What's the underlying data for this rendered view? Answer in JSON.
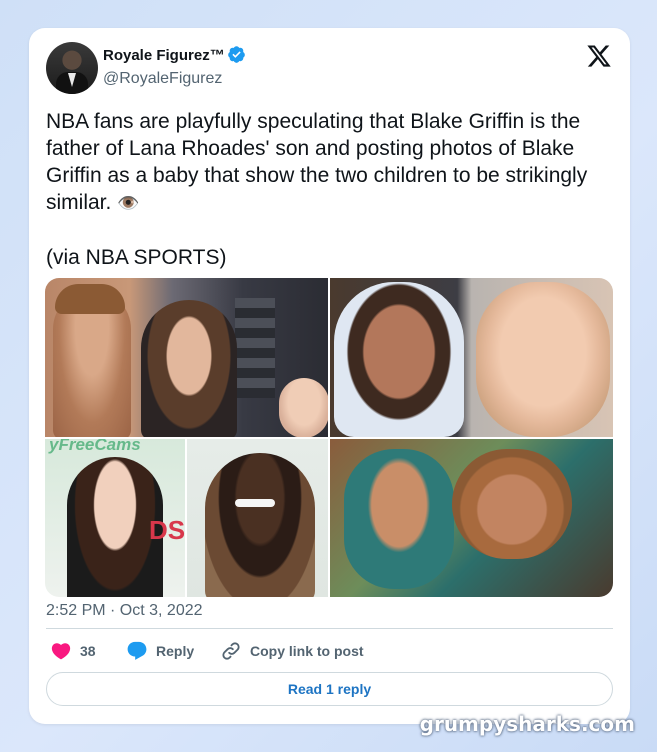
{
  "author": {
    "name": "Royale Figurez™",
    "handle": "@RoyaleFigurez",
    "verified": true
  },
  "tweet": {
    "text": "NBA fans are playfully speculating that Blake Griffin is the father of Lana Rhoades' son and posting photos of Blake Griffin as a baby that show the two children to be strikingly similar. ",
    "emoji": "👁️",
    "source_line": "(via NBA SPORTS)",
    "timestamp": "2:52 PM · Oct 3, 2022"
  },
  "media": {
    "tile3_sign": "yFreeCams",
    "tile3_banner": "DS"
  },
  "actions": {
    "like_count": "38",
    "reply_label": "Reply",
    "copy_label": "Copy link to post"
  },
  "read_replies_label": "Read 1 reply",
  "watermark": "grumpysharks.com",
  "colors": {
    "like": "#f91880",
    "reply": "#1d9bf0",
    "verified": "#1d9bf0",
    "link": "#1d74c3"
  },
  "icons": [
    "x-logo-icon",
    "verified-badge-icon",
    "heart-icon",
    "reply-bubble-icon",
    "link-icon"
  ]
}
